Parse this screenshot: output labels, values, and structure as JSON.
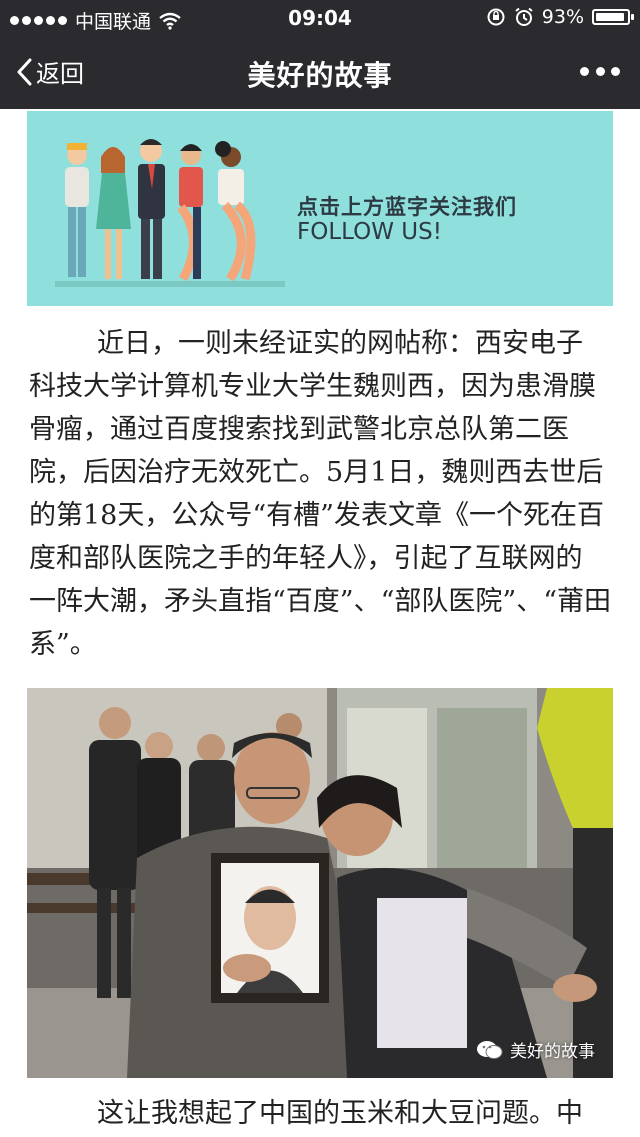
{
  "status_bar": {
    "carrier": "中国联通",
    "time": "09:04",
    "battery": "93%",
    "battery_level": 0.93
  },
  "nav": {
    "back_label": "返回",
    "title": "美好的故事"
  },
  "banner": {
    "follow_cn": "点击上方蓝字关注我们",
    "follow_en": "FOLLOW US!"
  },
  "article": {
    "paragraph1_lines": [
      "近日，一则未经证实的网帖称：西安电子",
      "科技大学计算机专业大学生魏则西，因为患滑膜",
      "骨瘤，通过百度搜索找到武警北京总队第二医",
      "院，后因治疗无效死亡。5月1日，魏则西去世后",
      "的第18天，公众号“有槽”发表文章《一个死在百",
      "度和部队医院之手的年轻人》，引起了互联网的",
      "一阵大潮，矛头直指“百度”、“部队医院”、“莆田",
      "系”。"
    ],
    "paragraph2_line": "这让我想起了中国的玉米和大豆问题。中"
  },
  "photo": {
    "watermark": "美好的故事"
  }
}
